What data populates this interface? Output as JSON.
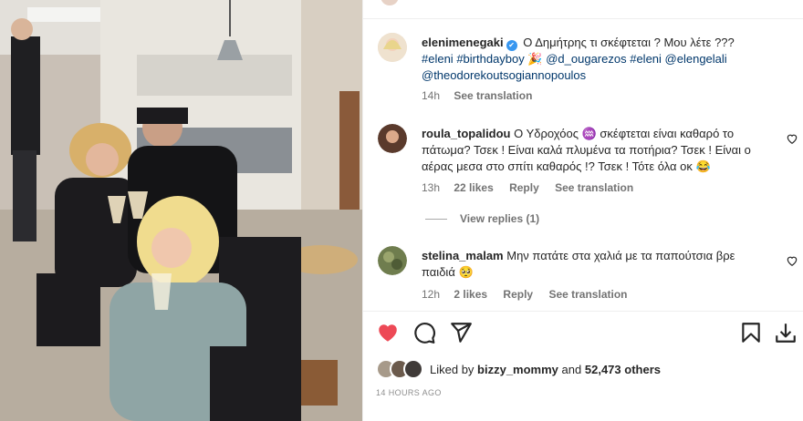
{
  "post": {
    "caption": {
      "username": "elenimenegaki",
      "text": "Ο Δημήτρης τι σκέφτεται ? Μου λέτε ???",
      "tags": [
        "#eleni",
        "#birthdayboy",
        "🎉",
        "@d_ougarezos",
        "#eleni",
        "@elengelali",
        "@theodorekoutsogiannopoulos"
      ],
      "time": "14h",
      "see_translation": "See translation"
    },
    "comments": [
      {
        "username": "roula_topalidou",
        "text": "Ο Υδροχόος ♒ σκέφτεται είναι καθαρό το πάτωμα? Τσεκ ! Είναι καλά πλυμένα τα ποτήρια? Τσεκ ! Είναι ο αέρας μεσα στο σπίτι καθαρός !? Τσεκ ! Τότε όλα οκ 😂",
        "time": "13h",
        "likes": "22 likes",
        "reply": "Reply",
        "see_translation": "See translation",
        "view_replies": "View replies (1)"
      },
      {
        "username": "stelina_malam",
        "text": "Μην πατάτε στα χαλιά με τα παπούτσια βρε παιδιά 🥺",
        "time": "12h",
        "likes": "2 likes",
        "reply": "Reply",
        "see_translation": "See translation"
      }
    ],
    "actions": {
      "like_icon": "heart-filled-icon",
      "comment_icon": "comment-icon",
      "share_icon": "share-icon",
      "save_icon": "bookmark-icon",
      "download_icon": "download-icon",
      "like_color": "#ed4956"
    },
    "liked_by": {
      "prefix": "Liked by",
      "user": "bizzy_mommy",
      "middle": "and",
      "others": "52,473 others"
    },
    "timestamp": "14 HOURS AGO"
  }
}
